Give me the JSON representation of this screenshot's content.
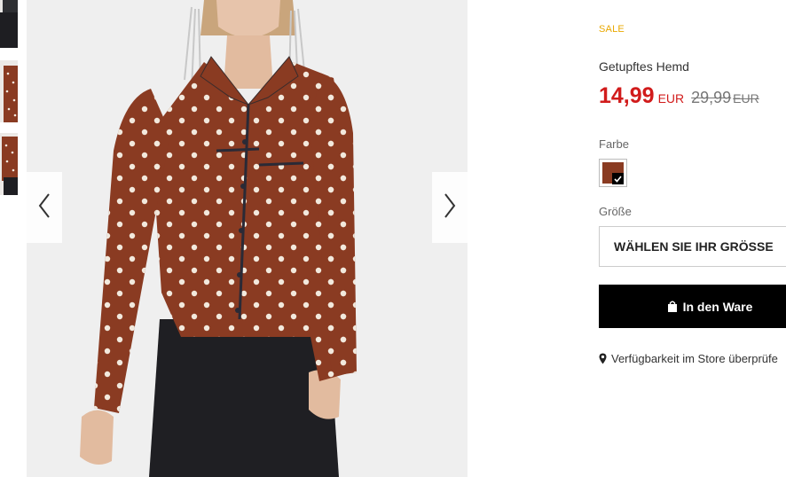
{
  "gallery": {
    "prev_icon": "chevron-left-icon",
    "next_icon": "chevron-right-icon"
  },
  "product": {
    "badge": "SALE",
    "name": "Getupftes Hemd",
    "price": "14,99",
    "currency": "EUR",
    "old_price": "29,99",
    "old_currency": "EUR",
    "colors": {
      "badge": "#e9a800",
      "price": "#d11b1b",
      "swatch": "#8a3b22"
    }
  },
  "color": {
    "label": "Farbe"
  },
  "size": {
    "label": "Größe",
    "placeholder": "WÄHLEN SIE IHR GRÖSSE"
  },
  "cart": {
    "label": "In den Ware",
    "icon": "shopping-bag-icon"
  },
  "store": {
    "label": "Verfügbarkeit im Store überprüfe",
    "icon": "location-pin-icon"
  }
}
